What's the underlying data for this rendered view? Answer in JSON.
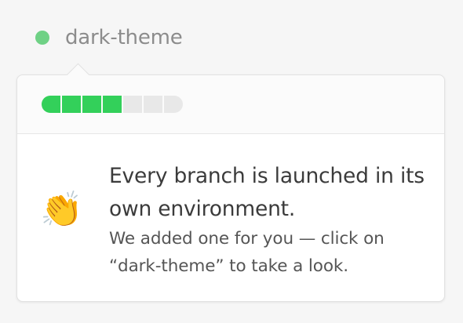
{
  "branch": {
    "name": "dark-theme",
    "status_color": "#6fd185"
  },
  "progress": {
    "segments_total": 7,
    "segments_complete": 4,
    "filled_color": "#33d05a",
    "empty_color": "#e8e8e8"
  },
  "message": {
    "icon": "clapping-hands-icon",
    "emoji": "👏",
    "title": "Every branch is launched in its own environment.",
    "body": "We added one for you — click on “dark-theme” to take a look."
  }
}
